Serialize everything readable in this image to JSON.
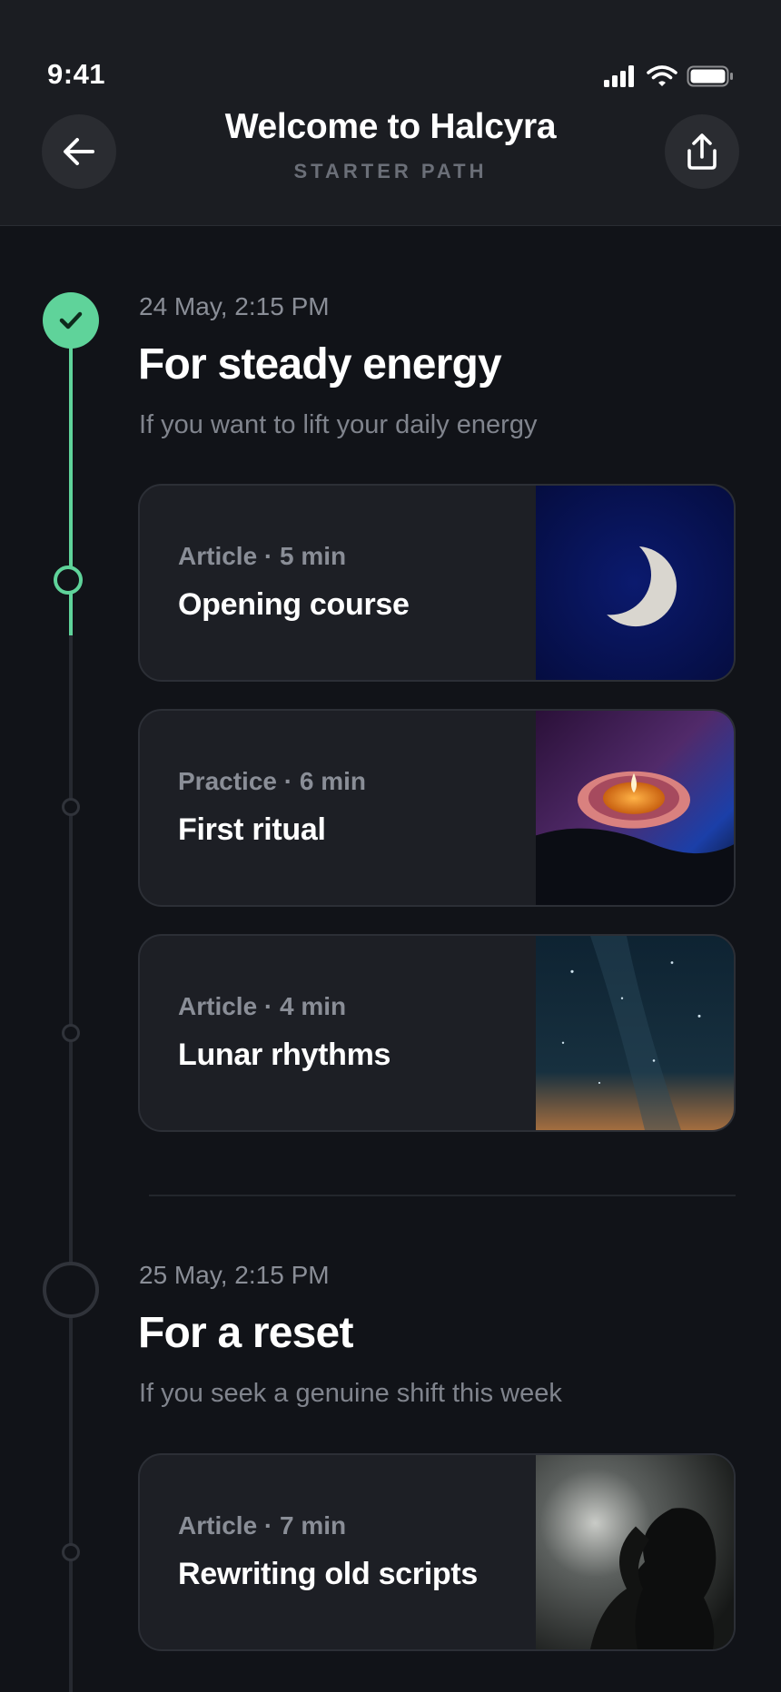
{
  "status_bar": {
    "time": "9:41"
  },
  "header": {
    "title": "Welcome to Halcyra",
    "subtitle": "STARTER PATH",
    "back_icon": "arrow-left-icon",
    "share_icon": "share-icon"
  },
  "colors": {
    "accent": "#5fd39a",
    "background": "#111318",
    "card": "#1d1f25"
  },
  "sections": [
    {
      "date": "24 May, 2:15 PM",
      "heading": "For steady energy",
      "description": "If you want to lift your daily energy",
      "completed": true,
      "items": [
        {
          "meta": "Article · 5 min",
          "title": "Opening course",
          "image": "crescent-moon"
        },
        {
          "meta": "Practice · 6 min",
          "title": "First ritual",
          "image": "candle"
        },
        {
          "meta": "Article · 4 min",
          "title": "Lunar rhythms",
          "image": "night-sky"
        }
      ]
    },
    {
      "date": "25 May, 2:15 PM",
      "heading": "For a reset",
      "description": "If you seek a genuine shift this week",
      "completed": false,
      "items": [
        {
          "meta": "Article · 7 min",
          "title": "Rewriting old scripts",
          "image": "silhouette"
        }
      ]
    }
  ]
}
